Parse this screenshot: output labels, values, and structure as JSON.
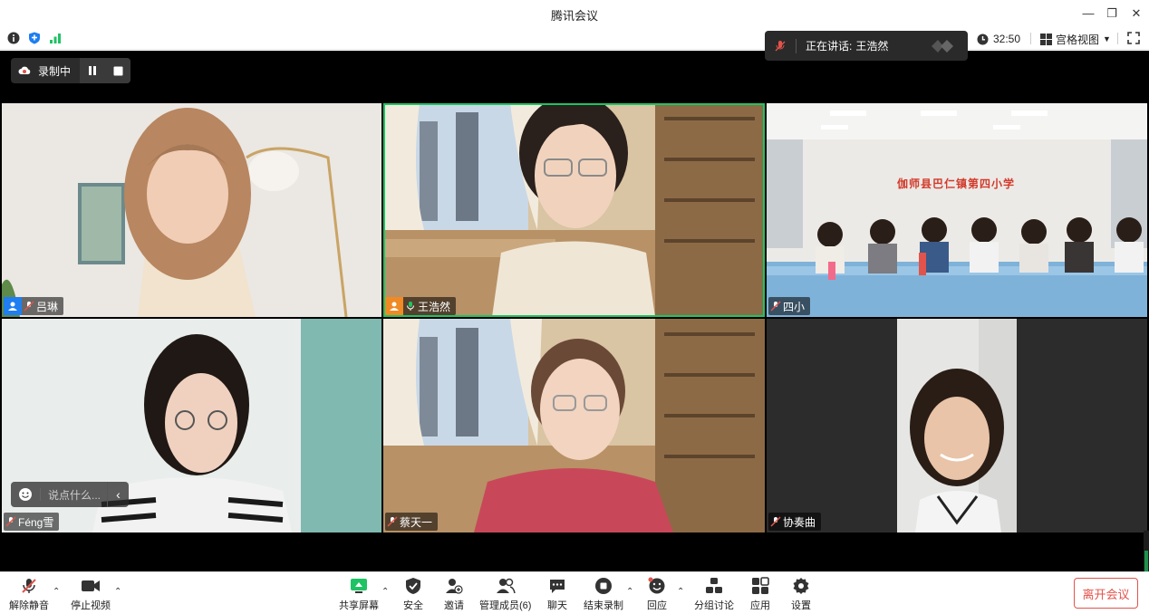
{
  "window": {
    "title": "腾讯会议"
  },
  "info": {
    "timer": "32:50",
    "view_mode": "宫格视图"
  },
  "recording": {
    "label": "录制中"
  },
  "speaking": {
    "prefix": "正在讲话:",
    "name": "王浩然"
  },
  "participants": [
    {
      "name": "吕琳",
      "host": true,
      "host_color": "#1e7ef2"
    },
    {
      "name": "王浩然",
      "host": true,
      "host_color": "#f08a24",
      "active": true
    },
    {
      "name": "四小"
    },
    {
      "name": "Féng雪"
    },
    {
      "name": "蔡天一"
    },
    {
      "name": "协奏曲"
    }
  ],
  "classroom_banner": "伽师县巴仁镇第四小学",
  "chat": {
    "placeholder": "说点什么..."
  },
  "toolbar": {
    "unmute": "解除静音",
    "stop_video": "停止视频",
    "share": "共享屏幕",
    "security": "安全",
    "invite": "邀请",
    "members": "管理成员(6)",
    "chat": "聊天",
    "stop_record": "结束录制",
    "react": "回应",
    "breakout": "分组讨论",
    "apps": "应用",
    "settings": "设置",
    "leave": "离开会议"
  },
  "colors": {
    "accent": "#1fc363",
    "leave": "#e2534b",
    "host_blue": "#1e7ef2",
    "host_orange": "#f08a24"
  }
}
